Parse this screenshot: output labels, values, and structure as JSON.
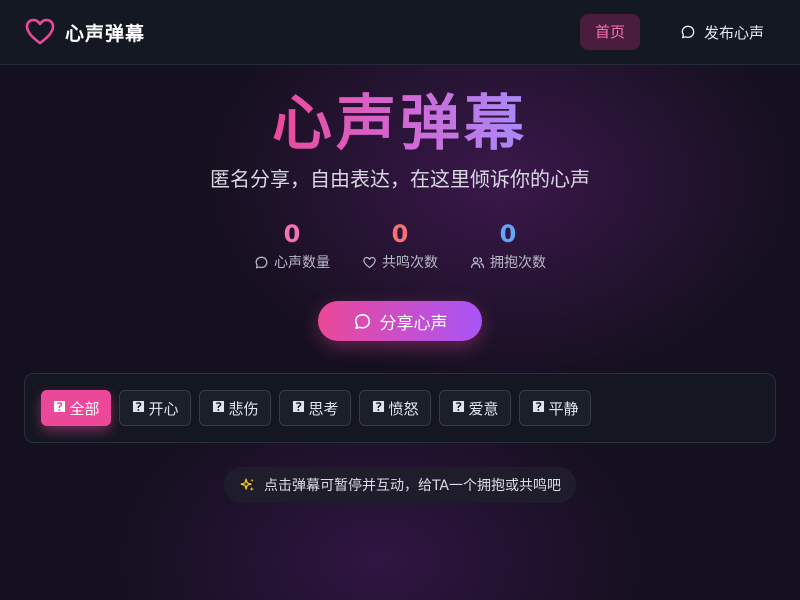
{
  "header": {
    "brand_name": "心声弹幕",
    "nav_home_label": "首页",
    "nav_post_label": "发布心声"
  },
  "hero": {
    "title": "心声弹幕",
    "subtitle": "匿名分享，自由表达，在这里倾诉你的心声"
  },
  "stats": [
    {
      "value": "0",
      "label": "心声数量",
      "icon": "chat-bubble-icon",
      "color": "#f472b6"
    },
    {
      "value": "0",
      "label": "共鸣次数",
      "icon": "heart-icon",
      "color": "#f87171"
    },
    {
      "value": "0",
      "label": "拥抱次数",
      "icon": "users-icon",
      "color": "#60a5fa"
    }
  ],
  "cta": {
    "label": "分享心声",
    "icon": "chat-bubble-icon"
  },
  "filters": {
    "active_index": 0,
    "glyph": "🯄",
    "items": [
      {
        "label": "全部"
      },
      {
        "label": "开心"
      },
      {
        "label": "悲伤"
      },
      {
        "label": "思考"
      },
      {
        "label": "愤怒"
      },
      {
        "label": "爱意"
      },
      {
        "label": "平静"
      }
    ]
  },
  "tip": {
    "text": "点击弹幕可暂停并互动，给TA一个拥抱或共鸣吧",
    "icon": "sparkles-icon"
  },
  "colors": {
    "accent_pink": "#ec4899",
    "accent_purple": "#a855f7",
    "background": "#15101f"
  }
}
